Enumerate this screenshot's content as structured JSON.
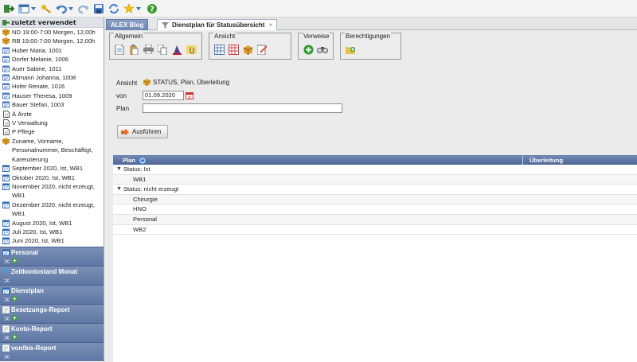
{
  "toolbar": {
    "icons": [
      "logout-icon",
      "window-layout-icon",
      "dropdown-arrow-icon",
      "key-icon",
      "undo-icon",
      "dropdown-arrow-icon",
      "redo-icon",
      "save-icon",
      "refresh-icon",
      "star-icon",
      "dropdown-arrow-icon",
      "help-icon"
    ]
  },
  "sidebar": {
    "header": "zuletzt verwendet",
    "items": [
      {
        "label": "ND 19:00-7:00 Morgen, 12,00h",
        "icon": "shift-cube-icon"
      },
      {
        "label": "RB 19:00-7:00 Morgen, 12,00h",
        "icon": "shift-cube-icon"
      },
      {
        "label": "Huber Maria, 1001",
        "icon": "person-card-icon"
      },
      {
        "label": "Dorfer Melanie, 1006",
        "icon": "person-card-icon"
      },
      {
        "label": "Auer Sabine, 1011",
        "icon": "person-card-icon"
      },
      {
        "label": "Altmann Johanna, 1008",
        "icon": "person-card-icon"
      },
      {
        "label": "Hofer Renate, 1016",
        "icon": "person-card-icon"
      },
      {
        "label": "Hauser Theresa, 1009",
        "icon": "person-card-icon"
      },
      {
        "label": "Bauer Stefan, 1003",
        "icon": "person-card-icon"
      },
      {
        "label": "Ä Ärzte",
        "icon": "document-icon"
      },
      {
        "label": "V Verwaltung",
        "icon": "document-icon"
      },
      {
        "label": "P Pflege",
        "icon": "document-icon"
      },
      {
        "label": "Zuname, Vorname, Personalnummer, Beschäftigt, Karenzierung",
        "icon": "shift-cube-icon"
      },
      {
        "label": "September 2020, Ist, WB1",
        "icon": "calendar-icon"
      },
      {
        "label": "Oktober 2020, Ist, WB1",
        "icon": "calendar-icon"
      },
      {
        "label": "November 2020, nicht erzeugt, WB1",
        "icon": "calendar-icon"
      },
      {
        "label": "Dezember 2020, nicht erzeugt, WB1",
        "icon": "calendar-icon"
      },
      {
        "label": "August 2020, Ist, WB1",
        "icon": "calendar-icon"
      },
      {
        "label": "Juli 2020, Ist, WB1",
        "icon": "calendar-icon"
      },
      {
        "label": "Juni 2020, Ist, WB1",
        "icon": "calendar-icon"
      }
    ],
    "panels": [
      {
        "title": "Personal",
        "icon": "person-card-icon"
      },
      {
        "title": "Zeitkontostand Monat",
        "icon": "clock-icon"
      },
      {
        "title": "Dienstplan",
        "icon": "calendar-icon"
      },
      {
        "title": "Besetzungs-Report",
        "icon": "report-icon"
      },
      {
        "title": "Konto-Report",
        "icon": "report-icon"
      },
      {
        "title": "von/bis-Report",
        "icon": "report-icon"
      }
    ]
  },
  "tabs": [
    {
      "label": "ALEX Blog",
      "state": "inactive"
    },
    {
      "label": "Dienstplan für Statusübersicht",
      "state": "active"
    }
  ],
  "groups": {
    "allgemein": "Allgemein",
    "ansicht": "Ansicht",
    "verweise": "Verweise",
    "berechtigungen": "Berechtigungen"
  },
  "form": {
    "ansicht_label": "Ansicht",
    "ansicht_value": "STATUS, Plan, Überleitung",
    "von_label": "von",
    "von_value": "01.09.2020",
    "plan_label": "Plan",
    "plan_value": "",
    "run_label": "Ausführen"
  },
  "table": {
    "columns": [
      "Plan",
      "Überleitung"
    ],
    "groups": [
      {
        "label": "Status: Ist",
        "rows": [
          "WB1"
        ]
      },
      {
        "label": "Status: nicht erzeugt",
        "rows": [
          "Chirurgie",
          "HNO",
          "Personal",
          "WB2"
        ]
      }
    ]
  },
  "colors": {
    "panel_blue": "#5d76a3",
    "table_header_blue": "#4e6697",
    "run_icon_orange": "#e0742a",
    "add_green": "#2e9a2e"
  }
}
